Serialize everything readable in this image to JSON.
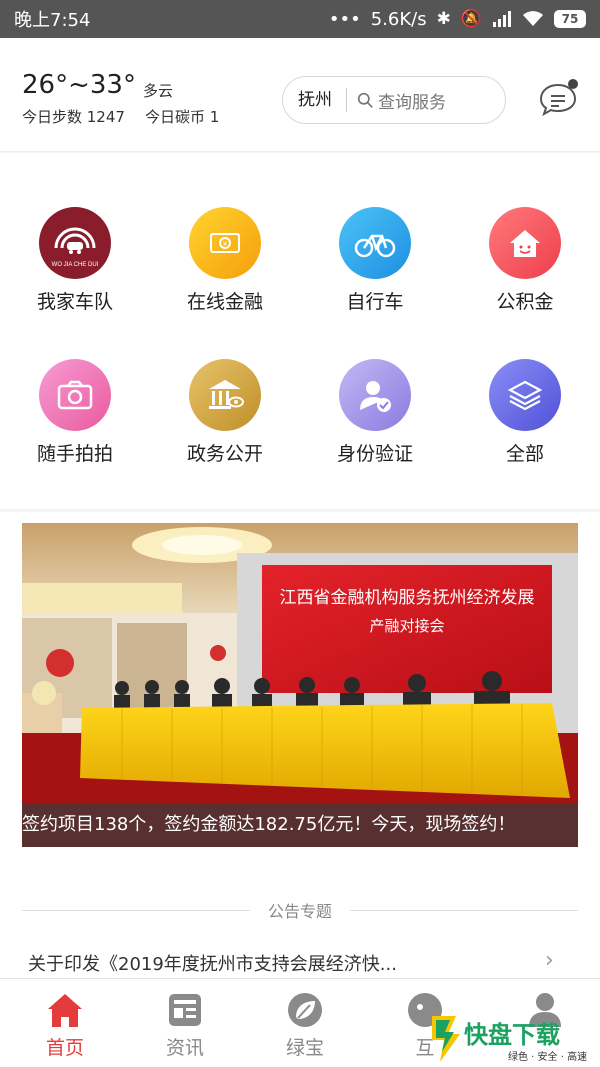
{
  "status_bar": {
    "time": "晚上7:54",
    "dots": "•••",
    "net_speed": "5.6K/s",
    "battery": "75"
  },
  "header": {
    "temperature": "26°~33°",
    "weather": "多云",
    "steps": "今日步数 1247",
    "coins": "今日碳币 1",
    "city": "抚州",
    "search_placeholder": "查询服务"
  },
  "services": [
    {
      "label": "我家车队",
      "icon": "car-team-icon",
      "color": "#8a1d2c",
      "sub": "WO JIA CHE DUI"
    },
    {
      "label": "在线金融",
      "icon": "money-icon",
      "color": "#f6b51e"
    },
    {
      "label": "自行车",
      "icon": "bicycle-icon",
      "color": "#35aef0"
    },
    {
      "label": "公积金",
      "icon": "house-fund-icon",
      "color": "#f0525a"
    },
    {
      "label": "随手拍拍",
      "icon": "camera-icon",
      "color": "#ee6fb0"
    },
    {
      "label": "政务公开",
      "icon": "government-icon",
      "color": "#d3a43b"
    },
    {
      "label": "身份验证",
      "icon": "identity-check-icon",
      "color": "#9c8ee6"
    },
    {
      "label": "全部",
      "icon": "layers-icon",
      "color": "#6a6fe8"
    }
  ],
  "banner": {
    "caption": "签约项目138个，签约金额达182.75亿元！今天，现场签约！",
    "stage_title": "江西省金融机构服务抚州经济发展",
    "stage_subtitle": "产融对接会"
  },
  "notices": {
    "heading": "公告专题",
    "items": [
      "关于印发《2019年度抚州市支持会展经济快..."
    ]
  },
  "tabs": [
    {
      "label": "首页",
      "icon": "home-icon",
      "active": true
    },
    {
      "label": "资讯",
      "icon": "news-icon",
      "active": false
    },
    {
      "label": "绿宝",
      "icon": "leaf-icon",
      "active": false
    },
    {
      "label": "互",
      "icon": "interact-icon",
      "active": false
    },
    {
      "label": "",
      "icon": "profile-icon",
      "active": false
    }
  ],
  "watermark": {
    "big": "快盘下载",
    "small": "绿色 · 安全 · 高速"
  },
  "colors": {
    "accent": "#e43c3c",
    "status_bg": "#555555"
  }
}
